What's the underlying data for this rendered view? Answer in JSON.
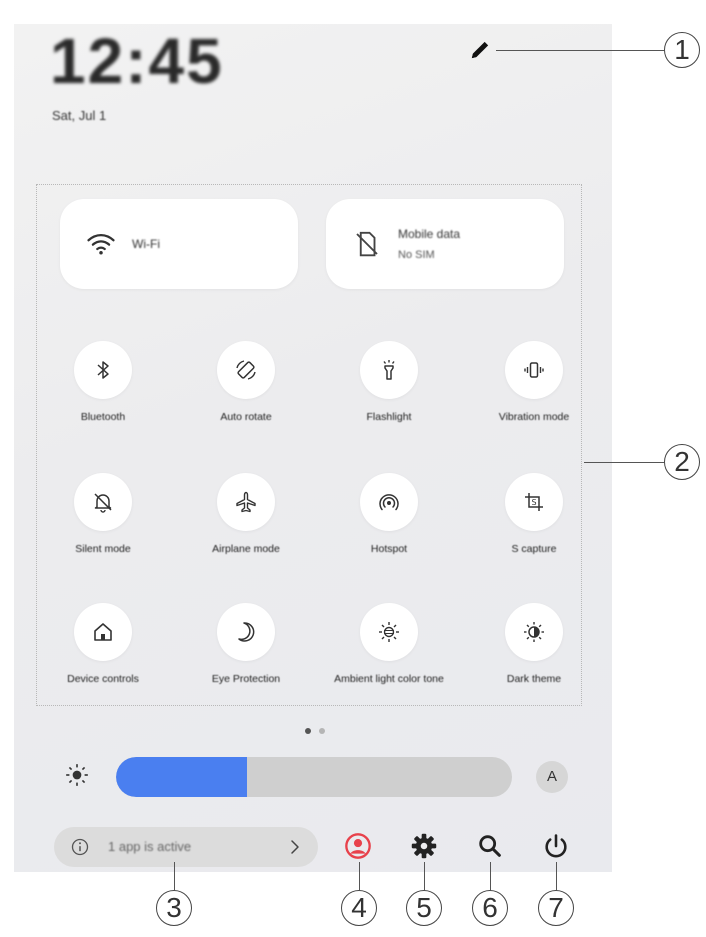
{
  "status": {
    "time": "12:45",
    "date": "Sat, Jul 1"
  },
  "connectivity": {
    "wifi": {
      "label": "Wi-Fi",
      "icon": "wifi-icon"
    },
    "mobile": {
      "label": "Mobile data",
      "sub": "No SIM",
      "icon": "no-sim-icon"
    }
  },
  "tiles": [
    {
      "label": "Bluetooth",
      "icon": "bluetooth-icon"
    },
    {
      "label": "Auto rotate",
      "icon": "auto-rotate-icon"
    },
    {
      "label": "Flashlight",
      "icon": "flashlight-icon"
    },
    {
      "label": "Vibration mode",
      "icon": "vibration-icon"
    },
    {
      "label": "Silent mode",
      "icon": "silent-icon"
    },
    {
      "label": "Airplane mode",
      "icon": "airplane-icon"
    },
    {
      "label": "Hotspot",
      "icon": "hotspot-icon"
    },
    {
      "label": "S capture",
      "icon": "s-capture-icon"
    },
    {
      "label": "Device controls",
      "icon": "home-icon"
    },
    {
      "label": "Eye Protection",
      "icon": "moon-icon"
    },
    {
      "label": "Ambient light color tone",
      "icon": "ambient-light-icon"
    },
    {
      "label": "Dark theme",
      "icon": "dark-theme-icon"
    }
  ],
  "brightness": {
    "level_percent": 33,
    "auto_label": "A",
    "fill_color": "#4a7ff0"
  },
  "bottom": {
    "active_apps": "1 app is active"
  },
  "callouts": [
    "1",
    "2",
    "3",
    "4",
    "5",
    "6",
    "7"
  ],
  "colors": {
    "accent": "#4a7ff0",
    "profile": "#e8414b",
    "tile_bg": "#ffffff"
  }
}
